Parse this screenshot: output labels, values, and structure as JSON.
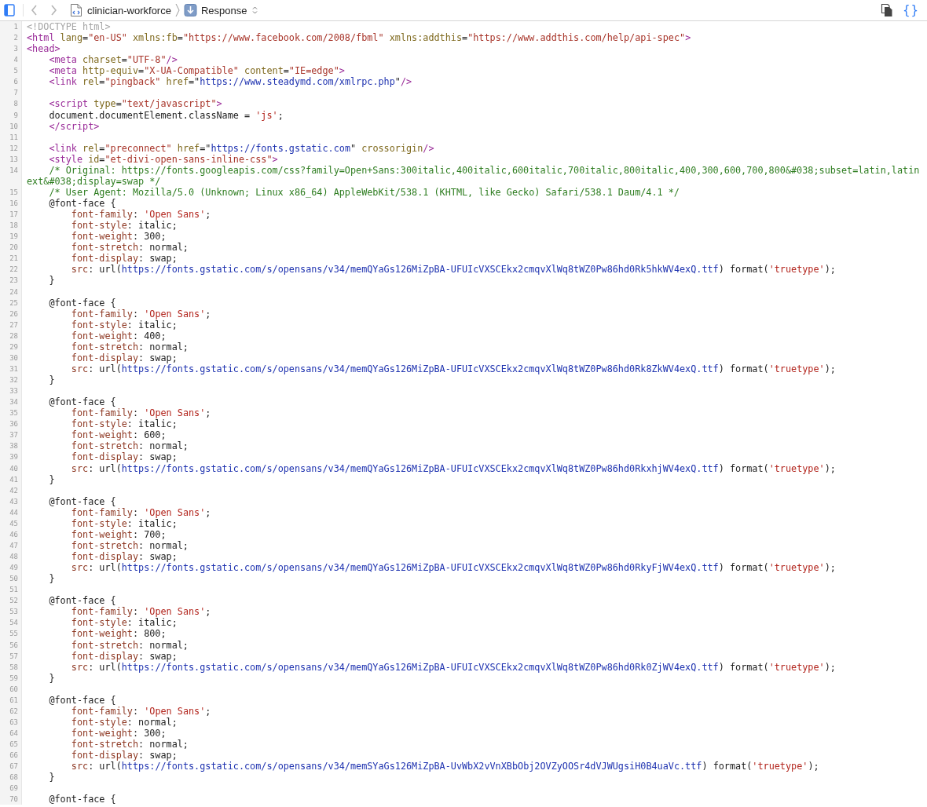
{
  "toolbar": {
    "sidebar_toggle": {
      "on": true
    },
    "back": {
      "disabled": true
    },
    "forward": {
      "disabled": true
    },
    "breadcrumbs": [
      {
        "kind": "file",
        "label": "clinician-workforce"
      },
      {
        "kind": "response",
        "label": "Response"
      }
    ],
    "pretty_print": {
      "label": "{}",
      "on": true
    }
  },
  "source": {
    "lines": [
      {
        "number": "1",
        "tokens": [
          {
            "kind": "doctype",
            "text": "<!DOCTYPE html>"
          }
        ]
      },
      {
        "number": "2",
        "tokens": [
          {
            "kind": "tag",
            "text": "<html"
          },
          {
            "kind": "attr",
            "text": " lang"
          },
          {
            "kind": "plain",
            "text": "="
          },
          {
            "kind": "value",
            "text": "\"en-US\""
          },
          {
            "kind": "attr",
            "text": " xmlns:fb"
          },
          {
            "kind": "plain",
            "text": "="
          },
          {
            "kind": "value",
            "text": "\"https://www.facebook.com/2008/fbml\""
          },
          {
            "kind": "attr",
            "text": " xmlns:addthis"
          },
          {
            "kind": "plain",
            "text": "="
          },
          {
            "kind": "value",
            "text": "\"https://www.addthis.com/help/api-spec\""
          },
          {
            "kind": "tag",
            "text": ">"
          }
        ]
      },
      {
        "number": "3",
        "tokens": [
          {
            "kind": "tag",
            "text": "<head>"
          }
        ]
      },
      {
        "number": "4",
        "tokens": [
          {
            "kind": "tag",
            "text": "    <meta"
          },
          {
            "kind": "attr",
            "text": " charset"
          },
          {
            "kind": "plain",
            "text": "="
          },
          {
            "kind": "value",
            "text": "\"UTF-8\""
          },
          {
            "kind": "tag",
            "text": "/>"
          }
        ]
      },
      {
        "number": "5",
        "tokens": [
          {
            "kind": "tag",
            "text": "    <meta"
          },
          {
            "kind": "attr",
            "text": " http-equiv"
          },
          {
            "kind": "plain",
            "text": "="
          },
          {
            "kind": "value",
            "text": "\"X-UA-Compatible\""
          },
          {
            "kind": "attr",
            "text": " content"
          },
          {
            "kind": "plain",
            "text": "="
          },
          {
            "kind": "value",
            "text": "\"IE=edge\""
          },
          {
            "kind": "tag",
            "text": ">"
          }
        ]
      },
      {
        "number": "6",
        "tokens": [
          {
            "kind": "tag",
            "text": "    <link"
          },
          {
            "kind": "attr",
            "text": " rel"
          },
          {
            "kind": "plain",
            "text": "="
          },
          {
            "kind": "value",
            "text": "\"pingback\""
          },
          {
            "kind": "attr",
            "text": " href"
          },
          {
            "kind": "plain",
            "text": "=\""
          },
          {
            "kind": "link",
            "text": "https://www.steadymd.com/xmlrpc.php"
          },
          {
            "kind": "plain",
            "text": "\""
          },
          {
            "kind": "tag",
            "text": "/>"
          }
        ]
      },
      {
        "number": "7"
      },
      {
        "number": "8",
        "tokens": [
          {
            "kind": "tag",
            "text": "    <script"
          },
          {
            "kind": "attr",
            "text": " type"
          },
          {
            "kind": "plain",
            "text": "="
          },
          {
            "kind": "value",
            "text": "\"text/javascript\""
          },
          {
            "kind": "tag",
            "text": ">"
          }
        ]
      },
      {
        "number": "9",
        "tokens": [
          {
            "kind": "plain",
            "text": "    document.documentElement.className = "
          },
          {
            "kind": "string",
            "text": "'js'"
          },
          {
            "kind": "plain",
            "text": ";"
          }
        ]
      },
      {
        "number": "10",
        "tokens": [
          {
            "kind": "tag",
            "text": "    </script>"
          }
        ]
      },
      {
        "number": "11"
      },
      {
        "number": "12",
        "tokens": [
          {
            "kind": "tag",
            "text": "    <link"
          },
          {
            "kind": "attr",
            "text": " rel"
          },
          {
            "kind": "plain",
            "text": "="
          },
          {
            "kind": "value",
            "text": "\"preconnect\""
          },
          {
            "kind": "attr",
            "text": " href"
          },
          {
            "kind": "plain",
            "text": "=\""
          },
          {
            "kind": "link",
            "text": "https://fonts.gstatic.com"
          },
          {
            "kind": "plain",
            "text": "\""
          },
          {
            "kind": "attr",
            "text": " crossorigin"
          },
          {
            "kind": "tag",
            "text": "/>"
          }
        ]
      },
      {
        "number": "13",
        "tokens": [
          {
            "kind": "tag",
            "text": "    <style"
          },
          {
            "kind": "attr",
            "text": " id"
          },
          {
            "kind": "plain",
            "text": "="
          },
          {
            "kind": "value",
            "text": "\"et-divi-open-sans-inline-css\""
          },
          {
            "kind": "tag",
            "text": ">"
          }
        ]
      },
      {
        "number": "14",
        "tokens": [
          {
            "kind": "comment",
            "text": "    /* Original: https://fonts.googleapis.com/css?family=Open+Sans:300italic,400italic,600italic,700italic,800italic,400,300,600,700,800&#038;subset=latin,latin"
          }
        ],
        "wrap": [
          {
            "kind": "comment",
            "text": "ext&#038;display=swap */"
          }
        ]
      },
      {
        "number": "15",
        "tokens": [
          {
            "kind": "comment",
            "text": "    /* User Agent: Mozilla/5.0 (Unknown; Linux x86_64) AppleWebKit/538.1 (KHTML, like Gecko) Safari/538.1 Daum/4.1 */"
          }
        ]
      },
      {
        "number": "16",
        "tokens": [
          {
            "kind": "plain",
            "text": "    @font-face {"
          }
        ]
      },
      {
        "number": "17",
        "tokens": [
          {
            "kind": "property",
            "text": "        font-family"
          },
          {
            "kind": "plain",
            "text": ": "
          },
          {
            "kind": "string",
            "text": "'Open Sans'"
          },
          {
            "kind": "plain",
            "text": ";"
          }
        ]
      },
      {
        "number": "18",
        "tokens": [
          {
            "kind": "property",
            "text": "        font-style"
          },
          {
            "kind": "plain",
            "text": ": italic;"
          }
        ]
      },
      {
        "number": "19",
        "tokens": [
          {
            "kind": "property",
            "text": "        font-weight"
          },
          {
            "kind": "plain",
            "text": ": 300;"
          }
        ]
      },
      {
        "number": "20",
        "tokens": [
          {
            "kind": "property",
            "text": "        font-stretch"
          },
          {
            "kind": "plain",
            "text": ": normal;"
          }
        ]
      },
      {
        "number": "21",
        "tokens": [
          {
            "kind": "property",
            "text": "        font-display"
          },
          {
            "kind": "plain",
            "text": ": swap;"
          }
        ]
      },
      {
        "number": "22",
        "tokens": [
          {
            "kind": "property",
            "text": "        src"
          },
          {
            "kind": "plain",
            "text": ": url("
          },
          {
            "kind": "link",
            "text": "https://fonts.gstatic.com/s/opensans/v34/memQYaGs126MiZpBA-UFUIcVXSCEkx2cmqvXlWq8tWZ0Pw86hd0Rk5hkWV4exQ.ttf"
          },
          {
            "kind": "plain",
            "text": ") format("
          },
          {
            "kind": "string",
            "text": "'truetype'"
          },
          {
            "kind": "plain",
            "text": ");"
          }
        ]
      },
      {
        "number": "23",
        "tokens": [
          {
            "kind": "plain",
            "text": "    }"
          }
        ]
      },
      {
        "number": "24"
      },
      {
        "number": "25",
        "tokens": [
          {
            "kind": "plain",
            "text": "    @font-face {"
          }
        ]
      },
      {
        "number": "26",
        "tokens": [
          {
            "kind": "property",
            "text": "        font-family"
          },
          {
            "kind": "plain",
            "text": ": "
          },
          {
            "kind": "string",
            "text": "'Open Sans'"
          },
          {
            "kind": "plain",
            "text": ";"
          }
        ]
      },
      {
        "number": "27",
        "tokens": [
          {
            "kind": "property",
            "text": "        font-style"
          },
          {
            "kind": "plain",
            "text": ": italic;"
          }
        ]
      },
      {
        "number": "28",
        "tokens": [
          {
            "kind": "property",
            "text": "        font-weight"
          },
          {
            "kind": "plain",
            "text": ": 400;"
          }
        ]
      },
      {
        "number": "29",
        "tokens": [
          {
            "kind": "property",
            "text": "        font-stretch"
          },
          {
            "kind": "plain",
            "text": ": normal;"
          }
        ]
      },
      {
        "number": "30",
        "tokens": [
          {
            "kind": "property",
            "text": "        font-display"
          },
          {
            "kind": "plain",
            "text": ": swap;"
          }
        ]
      },
      {
        "number": "31",
        "tokens": [
          {
            "kind": "property",
            "text": "        src"
          },
          {
            "kind": "plain",
            "text": ": url("
          },
          {
            "kind": "link",
            "text": "https://fonts.gstatic.com/s/opensans/v34/memQYaGs126MiZpBA-UFUIcVXSCEkx2cmqvXlWq8tWZ0Pw86hd0Rk8ZkWV4exQ.ttf"
          },
          {
            "kind": "plain",
            "text": ") format("
          },
          {
            "kind": "string",
            "text": "'truetype'"
          },
          {
            "kind": "plain",
            "text": ");"
          }
        ]
      },
      {
        "number": "32",
        "tokens": [
          {
            "kind": "plain",
            "text": "    }"
          }
        ]
      },
      {
        "number": "33"
      },
      {
        "number": "34",
        "tokens": [
          {
            "kind": "plain",
            "text": "    @font-face {"
          }
        ]
      },
      {
        "number": "35",
        "tokens": [
          {
            "kind": "property",
            "text": "        font-family"
          },
          {
            "kind": "plain",
            "text": ": "
          },
          {
            "kind": "string",
            "text": "'Open Sans'"
          },
          {
            "kind": "plain",
            "text": ";"
          }
        ]
      },
      {
        "number": "36",
        "tokens": [
          {
            "kind": "property",
            "text": "        font-style"
          },
          {
            "kind": "plain",
            "text": ": italic;"
          }
        ]
      },
      {
        "number": "37",
        "tokens": [
          {
            "kind": "property",
            "text": "        font-weight"
          },
          {
            "kind": "plain",
            "text": ": 600;"
          }
        ]
      },
      {
        "number": "38",
        "tokens": [
          {
            "kind": "property",
            "text": "        font-stretch"
          },
          {
            "kind": "plain",
            "text": ": normal;"
          }
        ]
      },
      {
        "number": "39",
        "tokens": [
          {
            "kind": "property",
            "text": "        font-display"
          },
          {
            "kind": "plain",
            "text": ": swap;"
          }
        ]
      },
      {
        "number": "40",
        "tokens": [
          {
            "kind": "property",
            "text": "        src"
          },
          {
            "kind": "plain",
            "text": ": url("
          },
          {
            "kind": "link",
            "text": "https://fonts.gstatic.com/s/opensans/v34/memQYaGs126MiZpBA-UFUIcVXSCEkx2cmqvXlWq8tWZ0Pw86hd0RkxhjWV4exQ.ttf"
          },
          {
            "kind": "plain",
            "text": ") format("
          },
          {
            "kind": "string",
            "text": "'truetype'"
          },
          {
            "kind": "plain",
            "text": ");"
          }
        ]
      },
      {
        "number": "41",
        "tokens": [
          {
            "kind": "plain",
            "text": "    }"
          }
        ]
      },
      {
        "number": "42"
      },
      {
        "number": "43",
        "tokens": [
          {
            "kind": "plain",
            "text": "    @font-face {"
          }
        ]
      },
      {
        "number": "44",
        "tokens": [
          {
            "kind": "property",
            "text": "        font-family"
          },
          {
            "kind": "plain",
            "text": ": "
          },
          {
            "kind": "string",
            "text": "'Open Sans'"
          },
          {
            "kind": "plain",
            "text": ";"
          }
        ]
      },
      {
        "number": "45",
        "tokens": [
          {
            "kind": "property",
            "text": "        font-style"
          },
          {
            "kind": "plain",
            "text": ": italic;"
          }
        ]
      },
      {
        "number": "46",
        "tokens": [
          {
            "kind": "property",
            "text": "        font-weight"
          },
          {
            "kind": "plain",
            "text": ": 700;"
          }
        ]
      },
      {
        "number": "47",
        "tokens": [
          {
            "kind": "property",
            "text": "        font-stretch"
          },
          {
            "kind": "plain",
            "text": ": normal;"
          }
        ]
      },
      {
        "number": "48",
        "tokens": [
          {
            "kind": "property",
            "text": "        font-display"
          },
          {
            "kind": "plain",
            "text": ": swap;"
          }
        ]
      },
      {
        "number": "49",
        "tokens": [
          {
            "kind": "property",
            "text": "        src"
          },
          {
            "kind": "plain",
            "text": ": url("
          },
          {
            "kind": "link",
            "text": "https://fonts.gstatic.com/s/opensans/v34/memQYaGs126MiZpBA-UFUIcVXSCEkx2cmqvXlWq8tWZ0Pw86hd0RkyFjWV4exQ.ttf"
          },
          {
            "kind": "plain",
            "text": ") format("
          },
          {
            "kind": "string",
            "text": "'truetype'"
          },
          {
            "kind": "plain",
            "text": ");"
          }
        ]
      },
      {
        "number": "50",
        "tokens": [
          {
            "kind": "plain",
            "text": "    }"
          }
        ]
      },
      {
        "number": "51"
      },
      {
        "number": "52",
        "tokens": [
          {
            "kind": "plain",
            "text": "    @font-face {"
          }
        ]
      },
      {
        "number": "53",
        "tokens": [
          {
            "kind": "property",
            "text": "        font-family"
          },
          {
            "kind": "plain",
            "text": ": "
          },
          {
            "kind": "string",
            "text": "'Open Sans'"
          },
          {
            "kind": "plain",
            "text": ";"
          }
        ]
      },
      {
        "number": "54",
        "tokens": [
          {
            "kind": "property",
            "text": "        font-style"
          },
          {
            "kind": "plain",
            "text": ": italic;"
          }
        ]
      },
      {
        "number": "55",
        "tokens": [
          {
            "kind": "property",
            "text": "        font-weight"
          },
          {
            "kind": "plain",
            "text": ": 800;"
          }
        ]
      },
      {
        "number": "56",
        "tokens": [
          {
            "kind": "property",
            "text": "        font-stretch"
          },
          {
            "kind": "plain",
            "text": ": normal;"
          }
        ]
      },
      {
        "number": "57",
        "tokens": [
          {
            "kind": "property",
            "text": "        font-display"
          },
          {
            "kind": "plain",
            "text": ": swap;"
          }
        ]
      },
      {
        "number": "58",
        "tokens": [
          {
            "kind": "property",
            "text": "        src"
          },
          {
            "kind": "plain",
            "text": ": url("
          },
          {
            "kind": "link",
            "text": "https://fonts.gstatic.com/s/opensans/v34/memQYaGs126MiZpBA-UFUIcVXSCEkx2cmqvXlWq8tWZ0Pw86hd0Rk0ZjWV4exQ.ttf"
          },
          {
            "kind": "plain",
            "text": ") format("
          },
          {
            "kind": "string",
            "text": "'truetype'"
          },
          {
            "kind": "plain",
            "text": ");"
          }
        ]
      },
      {
        "number": "59",
        "tokens": [
          {
            "kind": "plain",
            "text": "    }"
          }
        ]
      },
      {
        "number": "60"
      },
      {
        "number": "61",
        "tokens": [
          {
            "kind": "plain",
            "text": "    @font-face {"
          }
        ]
      },
      {
        "number": "62",
        "tokens": [
          {
            "kind": "property",
            "text": "        font-family"
          },
          {
            "kind": "plain",
            "text": ": "
          },
          {
            "kind": "string",
            "text": "'Open Sans'"
          },
          {
            "kind": "plain",
            "text": ";"
          }
        ]
      },
      {
        "number": "63",
        "tokens": [
          {
            "kind": "property",
            "text": "        font-style"
          },
          {
            "kind": "plain",
            "text": ": normal;"
          }
        ]
      },
      {
        "number": "64",
        "tokens": [
          {
            "kind": "property",
            "text": "        font-weight"
          },
          {
            "kind": "plain",
            "text": ": 300;"
          }
        ]
      },
      {
        "number": "65",
        "tokens": [
          {
            "kind": "property",
            "text": "        font-stretch"
          },
          {
            "kind": "plain",
            "text": ": normal;"
          }
        ]
      },
      {
        "number": "66",
        "tokens": [
          {
            "kind": "property",
            "text": "        font-display"
          },
          {
            "kind": "plain",
            "text": ": swap;"
          }
        ]
      },
      {
        "number": "67",
        "tokens": [
          {
            "kind": "property",
            "text": "        src"
          },
          {
            "kind": "plain",
            "text": ": url("
          },
          {
            "kind": "link",
            "text": "https://fonts.gstatic.com/s/opensans/v34/memSYaGs126MiZpBA-UvWbX2vVnXBbObj2OVZyOOSr4dVJWUgsiH0B4uaVc.ttf"
          },
          {
            "kind": "plain",
            "text": ") format("
          },
          {
            "kind": "string",
            "text": "'truetype'"
          },
          {
            "kind": "plain",
            "text": ");"
          }
        ]
      },
      {
        "number": "68",
        "tokens": [
          {
            "kind": "plain",
            "text": "    }"
          }
        ]
      },
      {
        "number": "69"
      },
      {
        "number": "70",
        "tokens": [
          {
            "kind": "plain",
            "text": "    @font-face {"
          }
        ]
      }
    ]
  }
}
